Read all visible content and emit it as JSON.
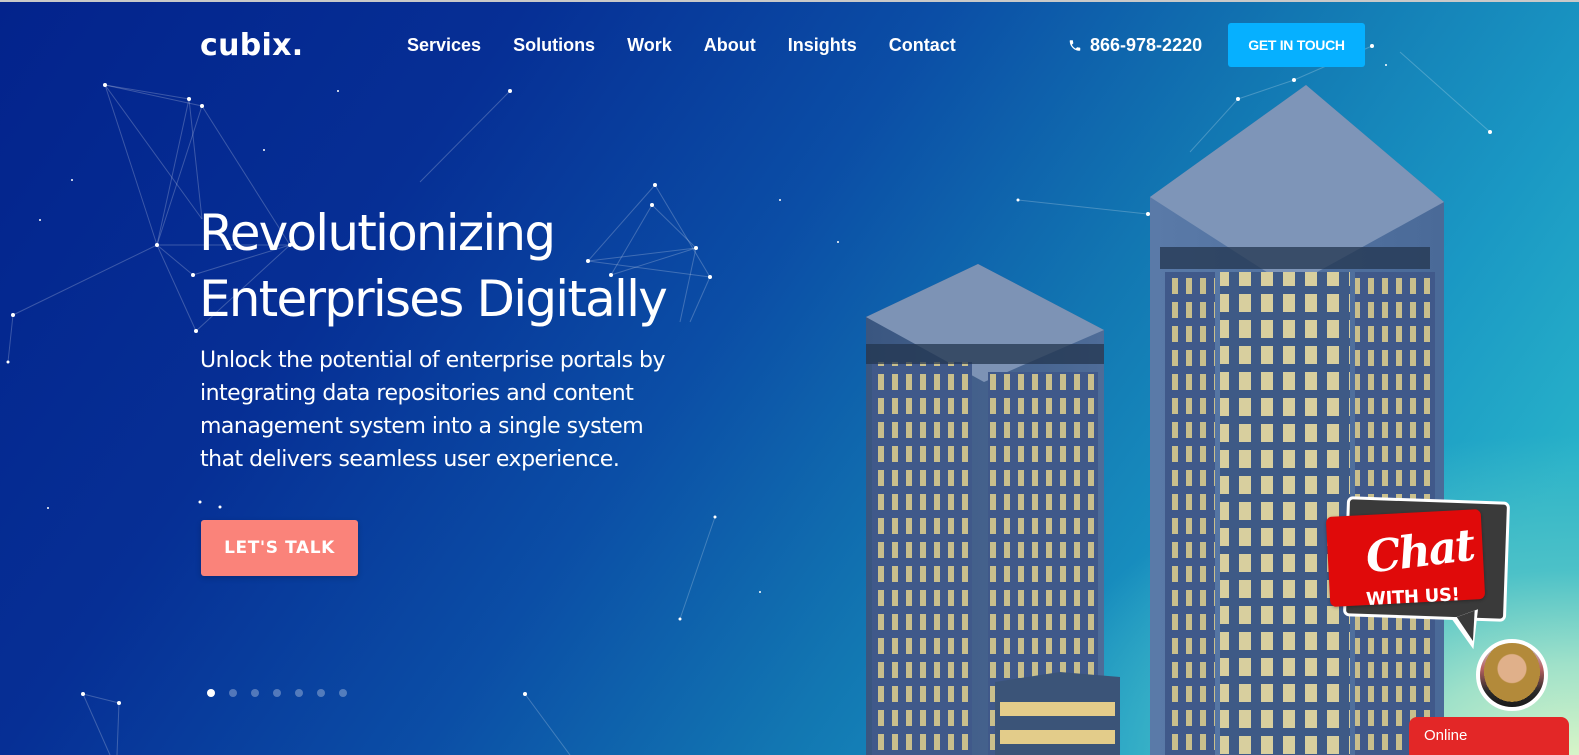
{
  "header": {
    "logo": "cubix.",
    "nav": [
      "Services",
      "Solutions",
      "Work",
      "About",
      "Insights",
      "Contact"
    ],
    "phone": "866-978-2220",
    "phone_icon": "phone-icon",
    "cta": "GET IN TOUCH"
  },
  "hero": {
    "headline": [
      "Revolutionizing",
      "Enterprises Digitally"
    ],
    "subtext": [
      "Unlock the potential of enterprise portals by",
      "integrating data repositories and content",
      "management system into a single system",
      "that delivers seamless user experience."
    ],
    "cta": "LET'S TALK",
    "slider": {
      "total": 7,
      "active": 1
    }
  },
  "chat": {
    "title": "Chat",
    "subtitle": "WITH US!",
    "status": "Online",
    "avatar_icon": "agent-avatar"
  },
  "colors": {
    "accent_blue": "#06b0ff",
    "cta_coral": "#fa837a",
    "chat_red": "#e32727"
  }
}
